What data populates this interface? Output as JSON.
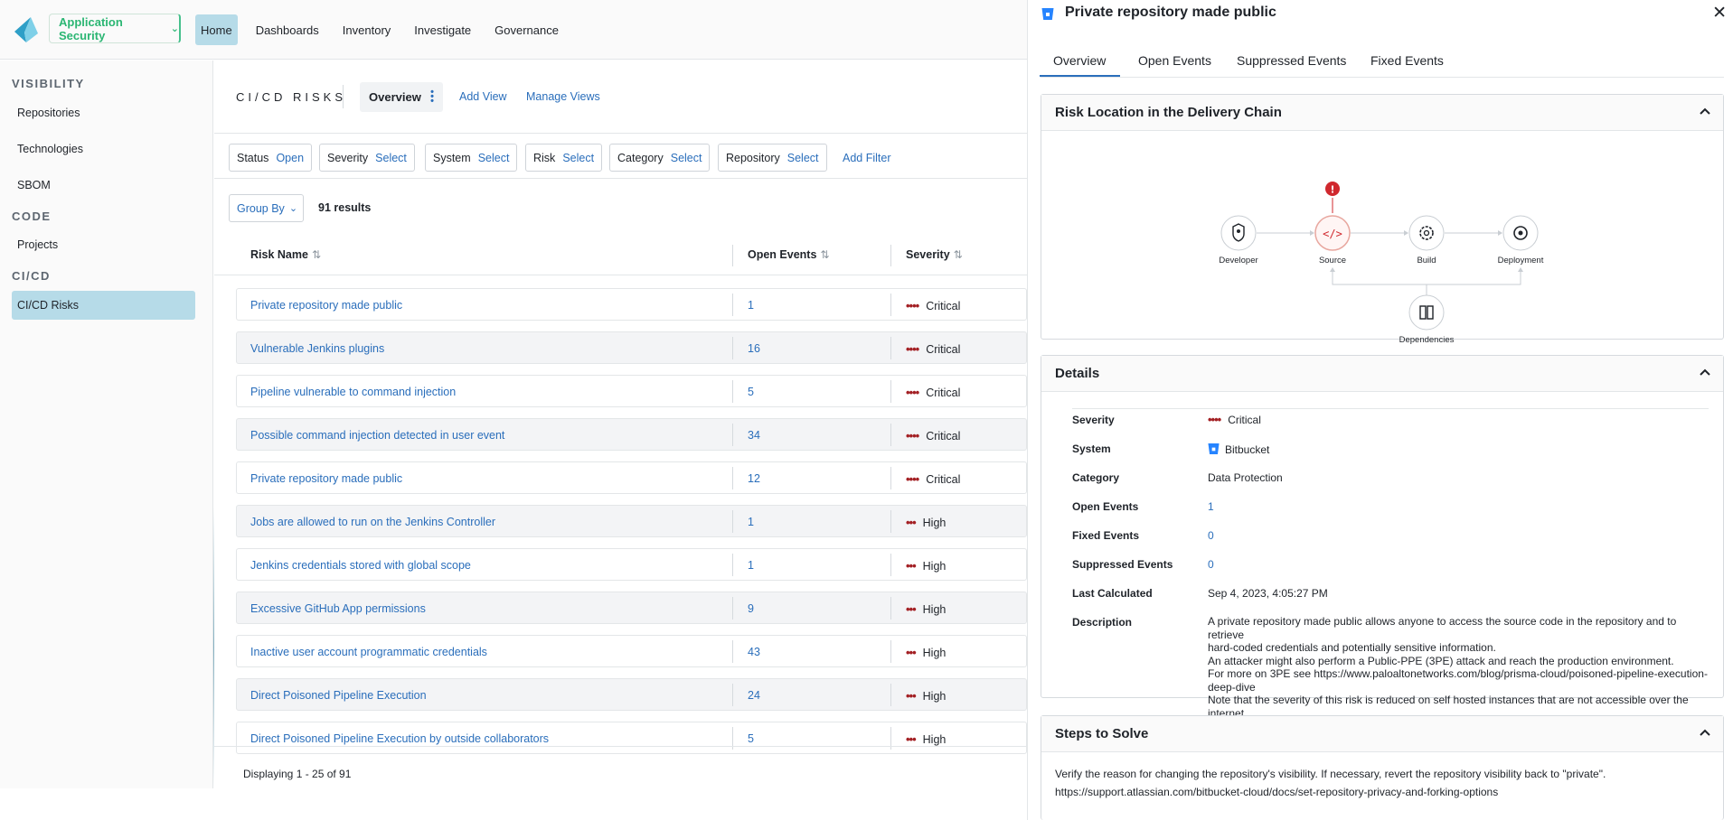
{
  "app": {
    "switcher_label": "Application Security",
    "nav": [
      "Home",
      "Dashboards",
      "Inventory",
      "Investigate",
      "Governance"
    ]
  },
  "sidebar": {
    "sections": [
      {
        "title": "VISIBILITY",
        "items": [
          "Repositories",
          "Technologies",
          "SBOM"
        ]
      },
      {
        "title": "CODE",
        "items": [
          "Projects"
        ]
      },
      {
        "title": "CI/CD",
        "items": [
          "CI/CD Risks"
        ]
      }
    ]
  },
  "page": {
    "title": "CI/CD RISKS",
    "view_tab": "Overview",
    "add_view": "Add View",
    "manage_views": "Manage Views"
  },
  "filters": [
    {
      "label": "Status",
      "value": "Open"
    },
    {
      "label": "Severity",
      "value": "Select"
    },
    {
      "label": "System",
      "value": "Select"
    },
    {
      "label": "Risk",
      "value": "Select"
    },
    {
      "label": "Category",
      "value": "Select"
    },
    {
      "label": "Repository",
      "value": "Select"
    }
  ],
  "add_filter": "Add Filter",
  "group_by": "Group By",
  "results": "91 results",
  "table": {
    "columns": [
      "Risk Name",
      "Open Events",
      "Severity"
    ],
    "rows": [
      {
        "name": "Private repository made public",
        "events": "1",
        "severity": "Critical",
        "dots": "••••"
      },
      {
        "name": "Vulnerable Jenkins plugins",
        "events": "16",
        "severity": "Critical",
        "dots": "••••"
      },
      {
        "name": "Pipeline vulnerable to command injection",
        "events": "5",
        "severity": "Critical",
        "dots": "••••"
      },
      {
        "name": "Possible command injection detected in user event",
        "events": "34",
        "severity": "Critical",
        "dots": "••••"
      },
      {
        "name": "Private repository made public",
        "events": "12",
        "severity": "Critical",
        "dots": "••••"
      },
      {
        "name": "Jobs are allowed to run on the Jenkins Controller",
        "events": "1",
        "severity": "High",
        "dots": "•••"
      },
      {
        "name": "Jenkins credentials stored with global scope",
        "events": "1",
        "severity": "High",
        "dots": "•••"
      },
      {
        "name": "Excessive GitHub App permissions",
        "events": "9",
        "severity": "High",
        "dots": "•••"
      },
      {
        "name": "Inactive user account programmatic credentials",
        "events": "43",
        "severity": "High",
        "dots": "•••"
      },
      {
        "name": "Direct Poisoned Pipeline Execution",
        "events": "24",
        "severity": "High",
        "dots": "•••"
      },
      {
        "name": "Direct Poisoned Pipeline Execution by outside collaborators",
        "events": "5",
        "severity": "High",
        "dots": "•••"
      }
    ],
    "footer": "Displaying 1 - 25 of 91"
  },
  "drawer": {
    "title": "Private repository made public",
    "tabs": [
      "Overview",
      "Open Events",
      "Suppressed Events",
      "Fixed Events"
    ],
    "chain_panel": {
      "title": "Risk Location in the Delivery Chain",
      "nodes": [
        "Developer",
        "Source",
        "Build",
        "Deployment",
        "Dependencies"
      ],
      "alert_node": "Source"
    },
    "details_panel": {
      "title": "Details",
      "severity_key": "Severity",
      "severity_val": "Critical",
      "system_key": "System",
      "system_val": "Bitbucket",
      "category_key": "Category",
      "category_val": "Data Protection",
      "open_key": "Open Events",
      "open_val": "1",
      "fixed_key": "Fixed Events",
      "fixed_val": "0",
      "suppressed_key": "Suppressed Events",
      "suppressed_val": "0",
      "calc_key": "Last Calculated",
      "calc_val": "Sep 4, 2023, 4:05:27 PM",
      "desc_key": "Description",
      "desc_lines": [
        "A private repository made public allows anyone to access the source code in the repository and to retrieve",
        "hard-coded credentials and potentially sensitive information.",
        "An attacker might also perform a Public-PPE (3PE) attack and reach the production environment.",
        "For more on 3PE see https://www.paloaltonetworks.com/blog/prisma-cloud/poisoned-pipeline-execution-",
        "deep-dive",
        "Note that the severity of this risk is reduced on self hosted instances that are not accessible over the internet."
      ]
    },
    "steps_panel": {
      "title": "Steps to Solve",
      "line1": "Verify the reason for changing the repository's visibility. If necessary, revert the repository visibility back to \"private\".",
      "line2": "https://support.atlassian.com/bitbucket-cloud/docs/set-repository-privacy-and-forking-options"
    }
  },
  "colors": {
    "accent": "#2a6ebb",
    "nav_active": "#b6dbe8",
    "critical": "#a32024",
    "brand_green": "#2bb673",
    "alert_red": "#d0282e"
  }
}
